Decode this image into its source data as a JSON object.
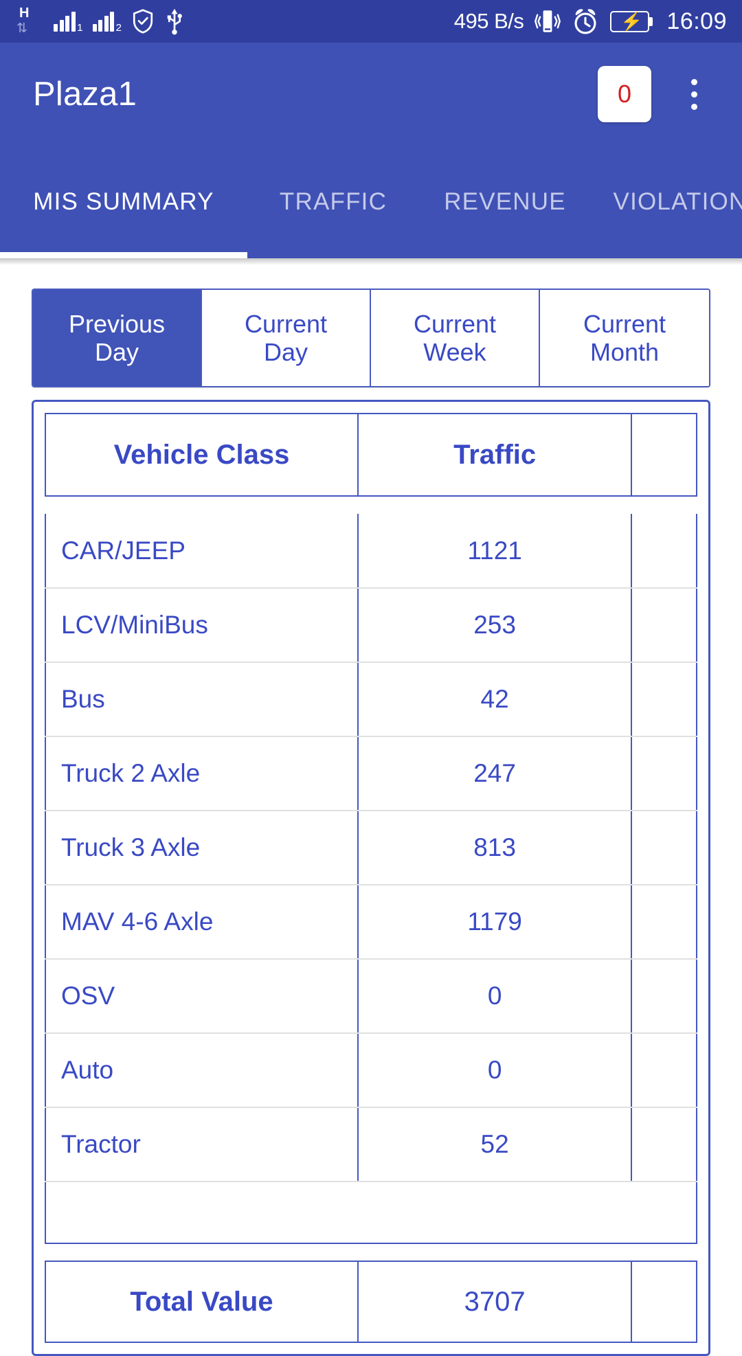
{
  "statusbar": {
    "network_type": "H",
    "sim1_label": "1",
    "sim2_label": "2",
    "net_speed": "495 B/s",
    "time": "16:09",
    "icons": [
      "hspa-data-icon",
      "signal-bars-sim1-icon",
      "signal-bars-sim2-icon",
      "shield-check-icon",
      "usb-icon",
      "vibrate-icon",
      "alarm-clock-icon",
      "battery-charging-icon"
    ]
  },
  "appbar": {
    "title": "Plaza1",
    "badge_count": "0",
    "overflow_label": "More options"
  },
  "tabs": [
    {
      "label": "MIS SUMMARY",
      "active": true
    },
    {
      "label": "TRAFFIC",
      "active": false
    },
    {
      "label": "REVENUE",
      "active": false
    },
    {
      "label": "VIOLATION",
      "active": false
    }
  ],
  "segments": [
    {
      "line1": "Previous",
      "line2": "Day",
      "selected": true
    },
    {
      "line1": "Current",
      "line2": "Day",
      "selected": false
    },
    {
      "line1": "Current",
      "line2": "Week",
      "selected": false
    },
    {
      "line1": "Current",
      "line2": "Month",
      "selected": false
    }
  ],
  "table": {
    "headers": [
      "Vehicle Class",
      "Traffic",
      ""
    ],
    "rows": [
      {
        "class": "CAR/JEEP",
        "traffic": "1121",
        "extra": ""
      },
      {
        "class": "LCV/MiniBus",
        "traffic": "253",
        "extra": ""
      },
      {
        "class": "Bus",
        "traffic": "42",
        "extra": ""
      },
      {
        "class": "Truck 2 Axle",
        "traffic": "247",
        "extra": ""
      },
      {
        "class": "Truck 3 Axle",
        "traffic": "813",
        "extra": ""
      },
      {
        "class": "MAV 4-6 Axle",
        "traffic": "1179",
        "extra": ""
      },
      {
        "class": "OSV",
        "traffic": "0",
        "extra": ""
      },
      {
        "class": "Auto",
        "traffic": "0",
        "extra": ""
      },
      {
        "class": "Tractor",
        "traffic": "52",
        "extra": ""
      }
    ],
    "total": {
      "label": "Total Value",
      "traffic": "3707",
      "extra": ""
    }
  },
  "colors": {
    "statusbar_bg": "#303F9F",
    "appbar_bg": "#3F51B5",
    "accent_blue": "#3949c4",
    "border_blue": "#4557c0",
    "selected_segment_bg": "#4154B8",
    "badge_text": "#D32020",
    "battery_green": "#4CD137"
  }
}
